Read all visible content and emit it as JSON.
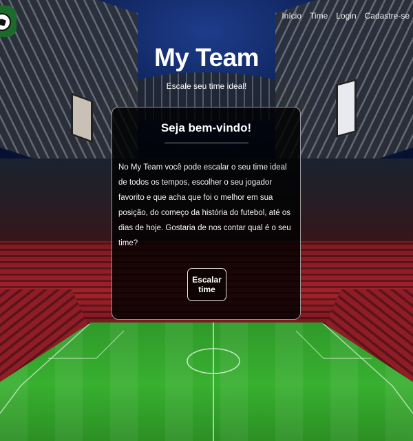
{
  "nav": {
    "items": [
      {
        "label": "Início"
      },
      {
        "label": "Time"
      },
      {
        "label": "Login"
      },
      {
        "label": "Cadastre-se"
      }
    ]
  },
  "hero": {
    "title": "My Team",
    "subtitle": "Escale seu time ideal!"
  },
  "card": {
    "title": "Seja bem-vindo!",
    "text": "No My Team você pode escalar o seu time ideal de todos os tempos, escolher o seu jogador favorito e que acha que foi o melhor em sua posição, do começo da história do futebol, até os dias de hoje. Gostaria de nos contar qual é o seu time?",
    "button_label": "Escalar time"
  },
  "icons": {
    "logo": "soccer-ball-icon"
  },
  "colors": {
    "logo_bg": "#1d6b2a",
    "card_bg": "rgba(0,0,0,0.82)",
    "card_border": "#9a9a9a"
  }
}
